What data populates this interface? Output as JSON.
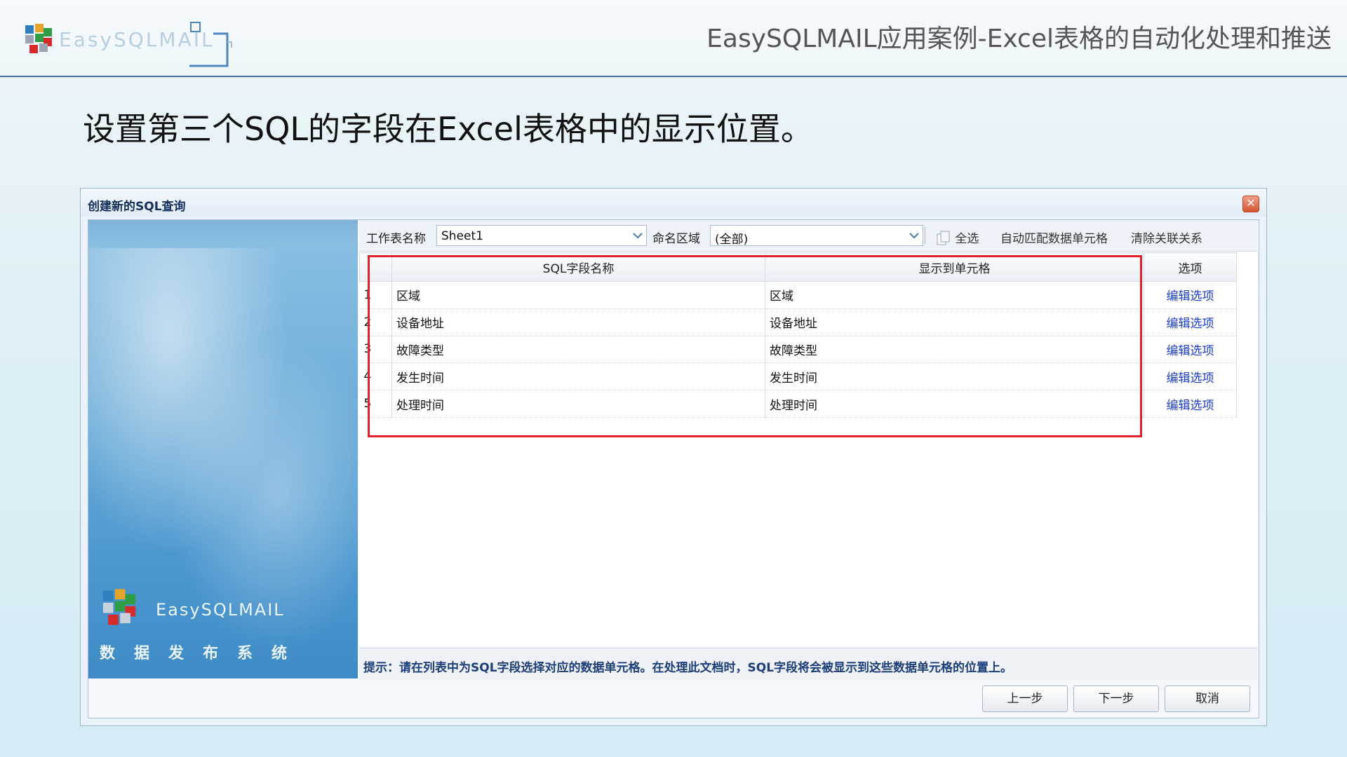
{
  "slide": {
    "logo_text": "EasySQLMAIL",
    "title": "EasySQLMAIL应用案例-Excel表格的自动化处理和推送",
    "subtitle": "设置第三个SQL的字段在Excel表格中的显示位置。"
  },
  "dialog": {
    "title": "创建新的SQL查询",
    "close_label": "✕",
    "banner": {
      "brand": "EasySQLMAIL",
      "tagline": "数据发布系统"
    },
    "toolbar": {
      "sheet_label": "工作表名称",
      "sheet_value": "Sheet1",
      "range_label": "命名区域",
      "range_value": "(全部)",
      "select_all": "全选",
      "auto_match": "自动匹配数据单元格",
      "clear_links": "清除关联关系"
    },
    "grid": {
      "columns": [
        "SQL字段名称",
        "显示到单元格",
        "选项"
      ],
      "rows": [
        {
          "num": "1",
          "field": "区域",
          "cell": "区域",
          "option": "编辑选项"
        },
        {
          "num": "2",
          "field": "设备地址",
          "cell": "设备地址",
          "option": "编辑选项"
        },
        {
          "num": "3",
          "field": "故障类型",
          "cell": "故障类型",
          "option": "编辑选项"
        },
        {
          "num": "4",
          "field": "发生时间",
          "cell": "发生时间",
          "option": "编辑选项"
        },
        {
          "num": "5",
          "field": "处理时间",
          "cell": "处理时间",
          "option": "编辑选项"
        }
      ]
    },
    "hint": "提示：请在列表中为SQL字段选择对应的数据单元格。在处理此文档时，SQL字段将会被显示到这些数据单元格的位置上。",
    "buttons": {
      "prev": "上一步",
      "next": "下一步",
      "cancel": "取消"
    }
  },
  "colors": {
    "highlight": "#e0232b",
    "link": "#1a3ccc",
    "header_rule": "#3c73a8"
  },
  "icons": [
    "logo-cubes-icon",
    "close-icon",
    "chevron-down-icon",
    "copy-icon"
  ]
}
